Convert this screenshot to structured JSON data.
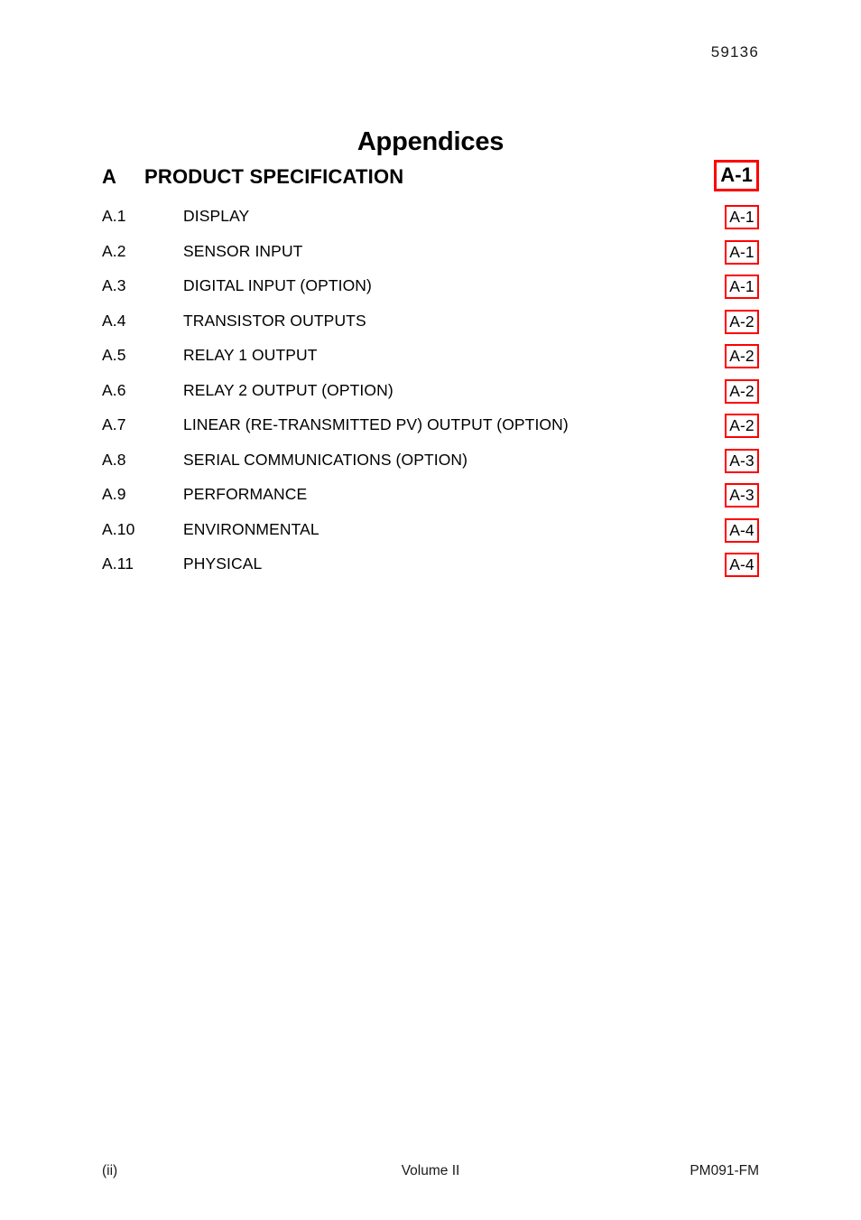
{
  "header": {
    "doc_number": "59136"
  },
  "page_title": "Appendices",
  "toc": {
    "entries": [
      {
        "number": "A",
        "title": "PRODUCT SPECIFICATION",
        "page": "A-1",
        "level": "major"
      },
      {
        "number": "A.1",
        "title": "DISPLAY",
        "page": "A-1",
        "level": "sub"
      },
      {
        "number": "A.2",
        "title": "SENSOR INPUT",
        "page": "A-1",
        "level": "sub"
      },
      {
        "number": "A.3",
        "title": "DIGITAL INPUT (OPTION)",
        "page": "A-1",
        "level": "sub"
      },
      {
        "number": "A.4",
        "title": "TRANSISTOR OUTPUTS",
        "page": "A-2",
        "level": "sub"
      },
      {
        "number": "A.5",
        "title": "RELAY 1 OUTPUT",
        "page": "A-2",
        "level": "sub"
      },
      {
        "number": "A.6",
        "title": "RELAY 2 OUTPUT (OPTION)",
        "page": "A-2",
        "level": "sub"
      },
      {
        "number": "A.7",
        "title": "LINEAR (RE-TRANSMITTED PV) OUTPUT (OPTION)",
        "page": "A-2",
        "level": "sub"
      },
      {
        "number": "A.8",
        "title": "SERIAL COMMUNICATIONS (OPTION)",
        "page": "A-3",
        "level": "sub"
      },
      {
        "number": "A.9",
        "title": "PERFORMANCE",
        "page": "A-3",
        "level": "sub"
      },
      {
        "number": "A.10",
        "title": "ENVIRONMENTAL",
        "page": "A-4",
        "level": "sub"
      },
      {
        "number": "A.11",
        "title": "PHYSICAL",
        "page": "A-4",
        "level": "sub"
      }
    ],
    "link_box_color": "#ff0000"
  },
  "footer": {
    "left": "(ii)",
    "center": "Volume II",
    "right": "PM091-FM"
  }
}
